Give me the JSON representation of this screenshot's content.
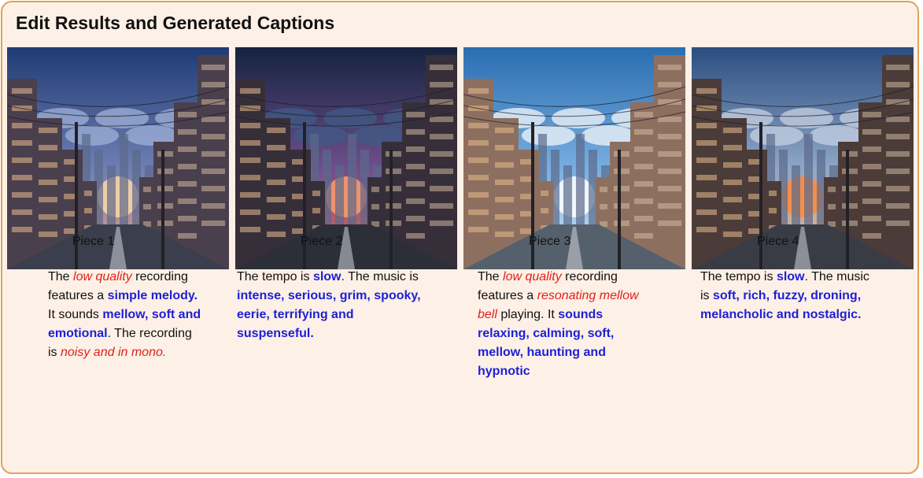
{
  "title": "Edit Results and Generated Captions",
  "colors": {
    "frame_border": "#e3a155",
    "panel_bg": "#fdf0e6",
    "highlight_red": "#e0211b",
    "highlight_blue": "#1d1fd6"
  },
  "pieces": [
    {
      "label": "Piece 1",
      "caption": [
        {
          "text": "The ",
          "style": "plain"
        },
        {
          "text": "low quality",
          "style": "red"
        },
        {
          "text": " recording features a ",
          "style": "plain"
        },
        {
          "text": "simple melody.",
          "style": "blue"
        },
        {
          "text": " It sounds ",
          "style": "plain"
        },
        {
          "text": "mellow, soft and emotional",
          "style": "blue"
        },
        {
          "text": ". The recording is ",
          "style": "plain"
        },
        {
          "text": "noisy and in mono.",
          "style": "red"
        }
      ]
    },
    {
      "label": "Piece 2",
      "caption": [
        {
          "text": "The tempo is ",
          "style": "plain"
        },
        {
          "text": "slow",
          "style": "blue"
        },
        {
          "text": ". The music is ",
          "style": "plain"
        },
        {
          "text": "intense, serious, grim, spooky, eerie, terrifying and suspenseful.",
          "style": "blue"
        }
      ]
    },
    {
      "label": "Piece 3",
      "caption": [
        {
          "text": "The ",
          "style": "plain"
        },
        {
          "text": "low quality",
          "style": "red"
        },
        {
          "text": " recording features a ",
          "style": "plain"
        },
        {
          "text": "resonating mellow bell",
          "style": "red"
        },
        {
          "text": " playing. It ",
          "style": "plain"
        },
        {
          "text": "sounds relaxing, calming, soft, mellow, haunting and hypnotic",
          "style": "blue"
        }
      ]
    },
    {
      "label": "Piece 4",
      "caption": [
        {
          "text": "The tempo is ",
          "style": "plain"
        },
        {
          "text": "slow",
          "style": "blue"
        },
        {
          "text": ". The music is ",
          "style": "plain"
        },
        {
          "text": "soft, rich, fuzzy, droning, melancholic and nostalgic.",
          "style": "blue"
        }
      ]
    }
  ],
  "scenes": [
    {
      "sky_top": "#1f3b74",
      "sky_mid": "#6f7fb4",
      "sky_bottom": "#f7a07a",
      "sun": "#ffd7a8",
      "cloud": "#9fb1d8",
      "tone": "#4a3f4d",
      "road": "#3b3e4c"
    },
    {
      "sky_top": "#15233f",
      "sky_mid": "#6e4f8d",
      "sky_bottom": "#f06a4f",
      "sun": "#ff9c6b",
      "cloud": "#3f5b86",
      "tone": "#362f3a",
      "road": "#2c2f38"
    },
    {
      "sky_top": "#2a6eb1",
      "sky_mid": "#78aee0",
      "sky_bottom": "#dbe8f2",
      "sun": "#ffffff",
      "cloud": "#f4f7fb",
      "tone": "#8d6f60",
      "road": "#54606c"
    },
    {
      "sky_top": "#2b4d80",
      "sky_mid": "#8fa7c9",
      "sky_bottom": "#ffb36b",
      "sun": "#ff8a3a",
      "cloud": "#c7d2e3",
      "tone": "#4b3c3a",
      "road": "#3a3c45"
    }
  ]
}
